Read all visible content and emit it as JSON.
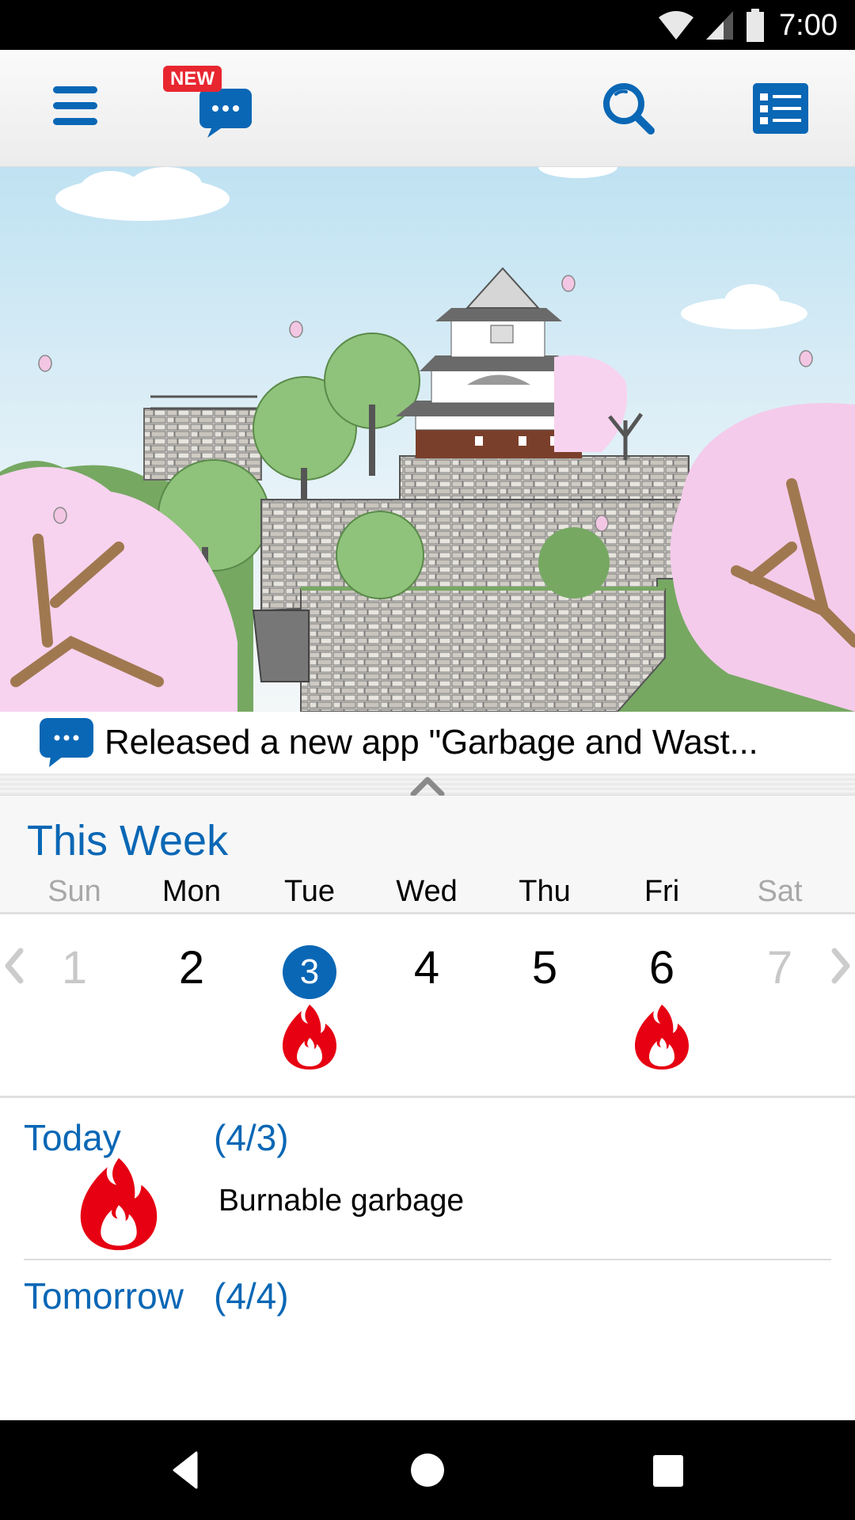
{
  "status_bar": {
    "time": "7:00",
    "icons": [
      "wifi-icon",
      "cell-signal-icon",
      "battery-icon"
    ]
  },
  "app_bar": {
    "menu_icon": "hamburger-menu-icon",
    "news_badge": "NEW",
    "news_icon": "chat-bubble-icon",
    "search_icon": "search-icon",
    "list_icon": "list-view-icon"
  },
  "banner": {
    "description": "Illustration of a Japanese castle on stone walls with cherry blossom trees"
  },
  "notice": {
    "icon": "chat-bubble-icon",
    "text": "Released a new app \"Garbage and Wast..."
  },
  "collapse": {
    "icon": "chevron-up-icon"
  },
  "week": {
    "title": "This Week",
    "days": [
      {
        "dow": "Sun",
        "date": "1",
        "muted": true,
        "today": false,
        "garbage": null
      },
      {
        "dow": "Mon",
        "date": "2",
        "muted": false,
        "today": false,
        "garbage": null
      },
      {
        "dow": "Tue",
        "date": "3",
        "muted": false,
        "today": true,
        "garbage": "burnable-flame-icon"
      },
      {
        "dow": "Wed",
        "date": "4",
        "muted": false,
        "today": false,
        "garbage": null
      },
      {
        "dow": "Thu",
        "date": "5",
        "muted": false,
        "today": false,
        "garbage": null
      },
      {
        "dow": "Fri",
        "date": "6",
        "muted": false,
        "today": false,
        "garbage": "burnable-flame-icon"
      },
      {
        "dow": "Sat",
        "date": "7",
        "muted": true,
        "today": false,
        "garbage": null
      }
    ],
    "prev_icon": "chevron-left-icon",
    "next_icon": "chevron-right-icon"
  },
  "details": {
    "today": {
      "label": "Today",
      "date": "(4/3)",
      "item": "Burnable garbage",
      "icon": "burnable-flame-icon"
    },
    "tomorrow": {
      "label": "Tomorrow",
      "date": "(4/4)"
    }
  },
  "colors": {
    "accent_blue": "#0a67b5",
    "flame_red": "#e60012",
    "badge_red": "#e8262f",
    "muted_gray": "#a8a8a8"
  },
  "nav_bar": {
    "back_icon": "back-triangle-icon",
    "home_icon": "home-circle-icon",
    "recents_icon": "recents-square-icon"
  }
}
